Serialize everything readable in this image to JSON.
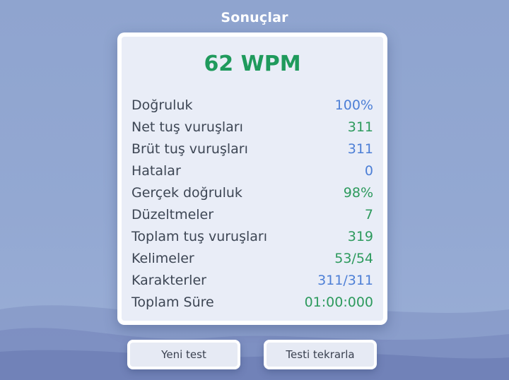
{
  "title": "Sonuçlar",
  "wpm": "62 WPM",
  "stats": [
    {
      "label": "Doğruluk",
      "value": "100%",
      "color": "blue"
    },
    {
      "label": "Net tuş vuruşları",
      "value": "311",
      "color": "green"
    },
    {
      "label": "Brüt tuş vuruşları",
      "value": "311",
      "color": "blue"
    },
    {
      "label": "Hatalar",
      "value": "0",
      "color": "blue"
    },
    {
      "label": "Gerçek doğruluk",
      "value": "98%",
      "color": "green"
    },
    {
      "label": "Düzeltmeler",
      "value": "7",
      "color": "green"
    },
    {
      "label": "Toplam tuş vuruşları",
      "value": "319",
      "color": "green"
    },
    {
      "label": "Kelimeler",
      "value": "53/54",
      "color": "green"
    },
    {
      "label": "Karakterler",
      "value": "311/311",
      "color": "blue"
    },
    {
      "label": "Toplam Süre",
      "value": "01:00:000",
      "color": "green"
    }
  ],
  "buttons": {
    "new_test": "Yeni test",
    "retry_test": "Testi tekrarla"
  },
  "colors": {
    "wpm": "#1f9a5c",
    "blue": "#4d7fd6",
    "green": "#2d9a5d",
    "background": "#93a8d2"
  }
}
